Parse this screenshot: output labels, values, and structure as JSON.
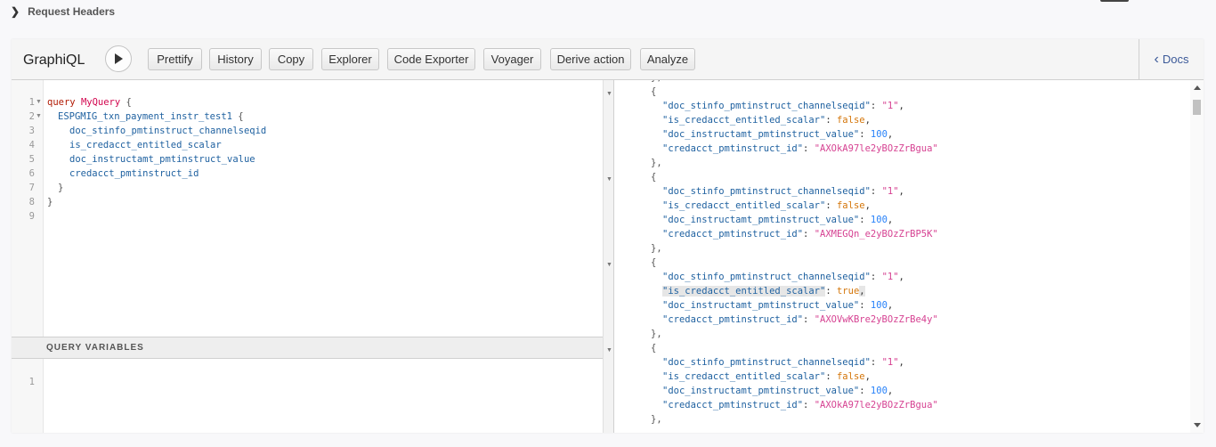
{
  "request_headers": {
    "label": "Request Headers"
  },
  "toolbar": {
    "title": "GraphiQL",
    "buttons": [
      "Prettify",
      "History",
      "Copy",
      "Explorer",
      "Code Exporter",
      "Voyager",
      "Derive action",
      "Analyze"
    ],
    "docs_label": "Docs"
  },
  "editor": {
    "line_numbers": [
      "1",
      "2",
      "3",
      "4",
      "5",
      "6",
      "7",
      "8",
      "9"
    ],
    "query_keyword": "query",
    "query_name": "MyQuery",
    "open_brace": "{",
    "close_brace": "}",
    "root_field": "ESPGMIG_txn_payment_instr_test1",
    "fields": [
      "doc_stinfo_pmtinstruct_channelseqid",
      "is_credacct_entitled_scalar",
      "doc_instructamt_pmtinstruct_value",
      "credacct_pmtinstruct_id"
    ]
  },
  "variables": {
    "header": "QUERY VARIABLES",
    "line_numbers": [
      "1"
    ]
  },
  "result": {
    "records": [
      {
        "channelseqid_key": "\"doc_stinfo_pmtinstruct_channelseqid\"",
        "channelseqid": "\"1\"",
        "entitled_key": "\"is_credacct_entitled_scalar\"",
        "entitled": "false",
        "value_key": "\"doc_instructamt_pmtinstruct_value\"",
        "value": "100",
        "id_key": "\"credacct_pmtinstruct_id\"",
        "id": "\"AXOkA97le2yBOzZrBgua\""
      },
      {
        "channelseqid_key": "\"doc_stinfo_pmtinstruct_channelseqid\"",
        "channelseqid": "\"1\"",
        "entitled_key": "\"is_credacct_entitled_scalar\"",
        "entitled": "false",
        "value_key": "\"doc_instructamt_pmtinstruct_value\"",
        "value": "100",
        "id_key": "\"credacct_pmtinstruct_id\"",
        "id": "\"AXMEGQn_e2yBOzZrBP5K\""
      },
      {
        "channelseqid_key": "\"doc_stinfo_pmtinstruct_channelseqid\"",
        "channelseqid": "\"1\"",
        "entitled_key": "\"is_credacct_entitled_scalar\"",
        "entitled": "true",
        "value_key": "\"doc_instructamt_pmtinstruct_value\"",
        "value": "100",
        "id_key": "\"credacct_pmtinstruct_id\"",
        "id": "\"AXOVwKBre2yBOzZrBe4y\""
      },
      {
        "channelseqid_key": "\"doc_stinfo_pmtinstruct_channelseqid\"",
        "channelseqid": "\"1\"",
        "entitled_key": "\"is_credacct_entitled_scalar\"",
        "entitled": "false",
        "value_key": "\"doc_instructamt_pmtinstruct_value\"",
        "value": "100",
        "id_key": "\"credacct_pmtinstruct_id\"",
        "id": "\"AXOkA97le2yBOzZrBgua\""
      }
    ],
    "highlighted_record": 2
  },
  "colors": {
    "keyword": "#b11a04",
    "def": "#d2054e",
    "field": "#1f61a0",
    "string": "#d64292",
    "boolean": "#d47509",
    "number": "#2882f9",
    "docs_link": "#3b5998"
  },
  "icons": {
    "expand": "chevron-right-icon",
    "execute": "play-icon",
    "docs": "chevron-left-icon",
    "fold": "fold-triangle-icon"
  }
}
